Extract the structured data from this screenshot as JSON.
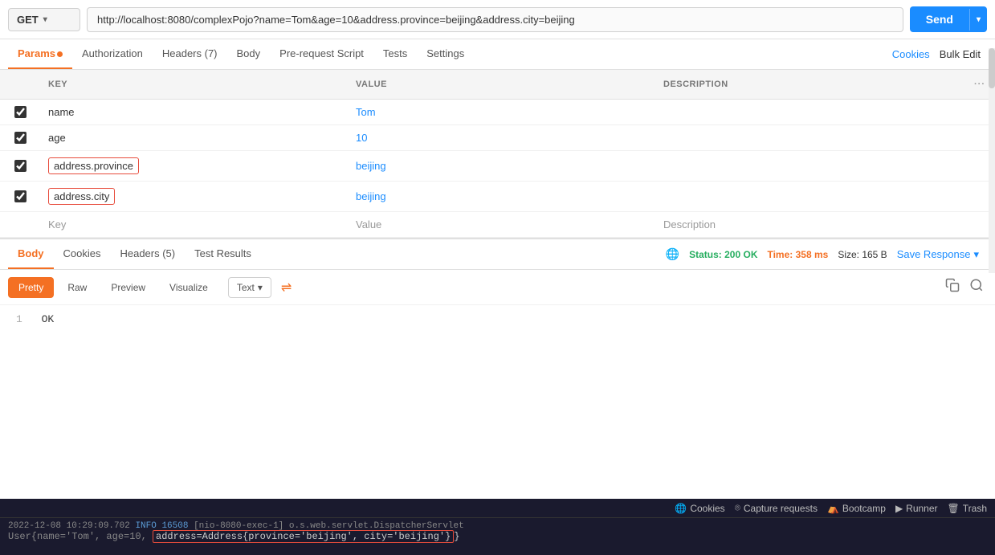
{
  "urlBar": {
    "method": "GET",
    "url": "http://localhost:8080/complexPojo?name=Tom&age=10&address.province=beijing&address.city=beijing",
    "sendLabel": "Send"
  },
  "tabs": {
    "items": [
      {
        "id": "params",
        "label": "Params",
        "active": true,
        "dot": true
      },
      {
        "id": "authorization",
        "label": "Authorization",
        "active": false
      },
      {
        "id": "headers",
        "label": "Headers (7)",
        "active": false
      },
      {
        "id": "body",
        "label": "Body",
        "active": false
      },
      {
        "id": "prerequest",
        "label": "Pre-request Script",
        "active": false
      },
      {
        "id": "tests",
        "label": "Tests",
        "active": false
      },
      {
        "id": "settings",
        "label": "Settings",
        "active": false
      }
    ],
    "cookies": "Cookies",
    "bulkEdit": "Bulk Edit",
    "keyHeader": "KEY",
    "valueHeader": "VALUE",
    "descHeader": "DESCRIPTION"
  },
  "params": {
    "rows": [
      {
        "id": 1,
        "checked": true,
        "key": "name",
        "value": "Tom",
        "description": "",
        "highlighted": false
      },
      {
        "id": 2,
        "checked": true,
        "key": "age",
        "value": "10",
        "description": "",
        "highlighted": false
      },
      {
        "id": 3,
        "checked": true,
        "key": "address.province",
        "value": "beijing",
        "description": "",
        "highlighted": true
      },
      {
        "id": 4,
        "checked": true,
        "key": "address.city",
        "value": "beijing",
        "description": "",
        "highlighted": true
      }
    ],
    "emptyKey": "Key",
    "emptyValue": "Value",
    "emptyDesc": "Description"
  },
  "bottomTabs": {
    "items": [
      {
        "id": "body",
        "label": "Body",
        "active": true
      },
      {
        "id": "cookies",
        "label": "Cookies"
      },
      {
        "id": "headers",
        "label": "Headers (5)"
      },
      {
        "id": "testresults",
        "label": "Test Results"
      }
    ],
    "status": "Status: 200 OK",
    "time": "Time: 358 ms",
    "size": "Size: 165 B",
    "saveResponse": "Save Response"
  },
  "formatBar": {
    "buttons": [
      "Pretty",
      "Raw",
      "Preview",
      "Visualize"
    ],
    "activeButton": "Pretty",
    "formatType": "Text",
    "wrapIcon": "⇌"
  },
  "responseBody": {
    "lineNumber": "1",
    "content": "OK"
  },
  "footer": {
    "tools": [
      {
        "id": "cookies",
        "icon": "🌐",
        "label": "Cookies"
      },
      {
        "id": "capture",
        "icon": "◎",
        "label": "Capture requests"
      },
      {
        "id": "bootcamp",
        "icon": "⛺",
        "label": "Bootcamp"
      },
      {
        "id": "runner",
        "icon": "▶",
        "label": "Runner"
      },
      {
        "id": "trash",
        "icon": "🗑",
        "label": "Trash"
      }
    ],
    "logLine1": "2022-12-08 10:29:09.702   INFO 16508   [nio-8080-exec-1] o.s.web.servlet.DispatcherServlet",
    "logLine2Prefix": "User{name='Tom', age=10, ",
    "logLine2Highlight": "address=Address{province='beijing', city='beijing'}",
    "logLine2Suffix": "}"
  }
}
